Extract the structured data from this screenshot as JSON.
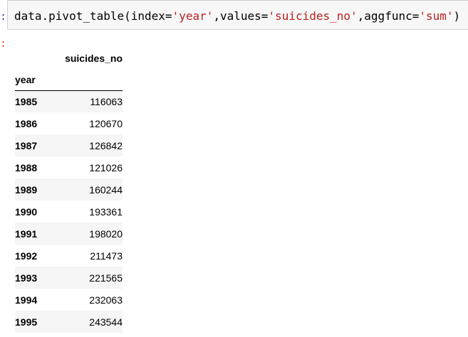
{
  "cell": {
    "input_prompt": ":",
    "output_prompt": ":",
    "code": {
      "prefix": "data.pivot_table(index=",
      "index_arg": "'year'",
      "sep1": ",values=",
      "values_arg": "'suicides_no'",
      "sep2": ",aggfunc=",
      "aggfunc_arg": "'sum'",
      "suffix": ")"
    }
  },
  "dataframe": {
    "column_header": "suicides_no",
    "index_name": "year",
    "rows": [
      {
        "year": "1985",
        "suicides_no": "116063"
      },
      {
        "year": "1986",
        "suicides_no": "120670"
      },
      {
        "year": "1987",
        "suicides_no": "126842"
      },
      {
        "year": "1988",
        "suicides_no": "121026"
      },
      {
        "year": "1989",
        "suicides_no": "160244"
      },
      {
        "year": "1990",
        "suicides_no": "193361"
      },
      {
        "year": "1991",
        "suicides_no": "198020"
      },
      {
        "year": "1992",
        "suicides_no": "211473"
      },
      {
        "year": "1993",
        "suicides_no": "221565"
      },
      {
        "year": "1994",
        "suicides_no": "232063"
      },
      {
        "year": "1995",
        "suicides_no": "243544"
      }
    ]
  },
  "colors": {
    "string_literal": "#ba2121",
    "input_prompt": "#303f9f",
    "output_prompt": "#d84315",
    "cell_background": "#f7f7f7",
    "cell_border": "#cfcfcf",
    "striped_row": "#f5f5f5"
  }
}
